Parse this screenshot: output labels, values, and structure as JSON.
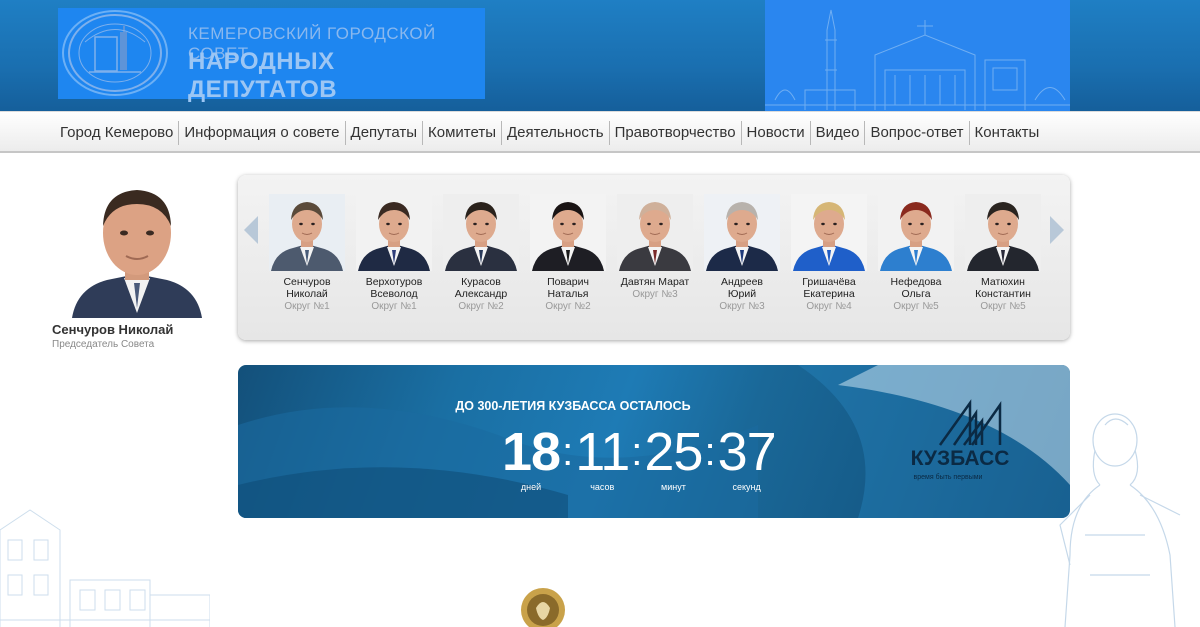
{
  "header": {
    "title_line1": "КЕМЕРОВСКИЙ ГОРОДСКОЙ СОВЕТ",
    "title_line2": "НАРОДНЫХ ДЕПУТАТОВ",
    "seal_icon": "city-seal-icon"
  },
  "nav": [
    "Город Кемерово",
    "Информация о совете",
    "Депутаты",
    "Комитеты",
    "Деятельность",
    "Правотворчество",
    "Новости",
    "Видео",
    "Вопрос-ответ",
    "Контакты"
  ],
  "chairman": {
    "name": "Сенчуров Николай",
    "role": "Председатель Совета"
  },
  "deputies": [
    {
      "first": "Сенчуров",
      "last": "Николай",
      "district": "Округ №1",
      "tie": "#4a5d7a",
      "suit": "#4d5a6e",
      "hair": "#5a4a3a",
      "bg": "#e9eef3"
    },
    {
      "first": "Верхотуров",
      "last": "Всеволод",
      "district": "Округ №1",
      "tie": "#2f3e7a",
      "suit": "#1f2a44",
      "hair": "#3a2a22",
      "bg": "#f2f2f2"
    },
    {
      "first": "Курасов",
      "last": "Александр",
      "district": "Округ №2",
      "tie": "#2a3a5a",
      "suit": "#2a3040",
      "hair": "#2a221c",
      "bg": "#eeeeee"
    },
    {
      "first": "Поварич",
      "last": "Наталья",
      "district": "Округ №2",
      "tie": "#1a1a1a",
      "suit": "#1e1e24",
      "hair": "#1a1414",
      "bg": "#f3f3f3"
    },
    {
      "first": "Давтян Марат",
      "last": "",
      "district": "Округ №3",
      "tie": "#7a2a2a",
      "suit": "#3a3a40",
      "hair": "#cfb09a",
      "bg": "#eeeeee"
    },
    {
      "first": "Андреев",
      "last": "Юрий",
      "district": "Округ №3",
      "tie": "#1f3a7a",
      "suit": "#1c2a48",
      "hair": "#b8b2ac",
      "bg": "#eef1f5"
    },
    {
      "first": "Гришачёва",
      "last": "Екатерина",
      "district": "Округ №4",
      "tie": "#1f5bc4",
      "suit": "#1f5fc9",
      "hair": "#d6b676",
      "bg": "#f4f4f4"
    },
    {
      "first": "Нефедова",
      "last": "Ольга",
      "district": "Округ №5",
      "tie": "#2f7fd0",
      "suit": "#2d7fcf",
      "hair": "#8a2a1e",
      "bg": "#f2f2f2"
    },
    {
      "first": "Матюхин",
      "last": "Константин",
      "district": "Округ №5",
      "tie": "#2a2a3a",
      "suit": "#23262e",
      "hair": "#2a2420",
      "bg": "#eeeeee"
    }
  ],
  "countdown": {
    "title": "ДО 300-ЛЕТИЯ КУЗБАССА ОСТАЛОСЬ",
    "days": "18",
    "hours": "11",
    "minutes": "25",
    "seconds": "37",
    "days_label": "дней",
    "hours_label": "часов",
    "minutes_label": "минут",
    "seconds_label": "секунд",
    "brand": "КУЗБАСС",
    "slogan": "время быть первыми"
  },
  "colors": {
    "header_bg": "#1a6fb0",
    "logo_bg": "#1e86f0",
    "banner_dark": "#0f4a74"
  }
}
